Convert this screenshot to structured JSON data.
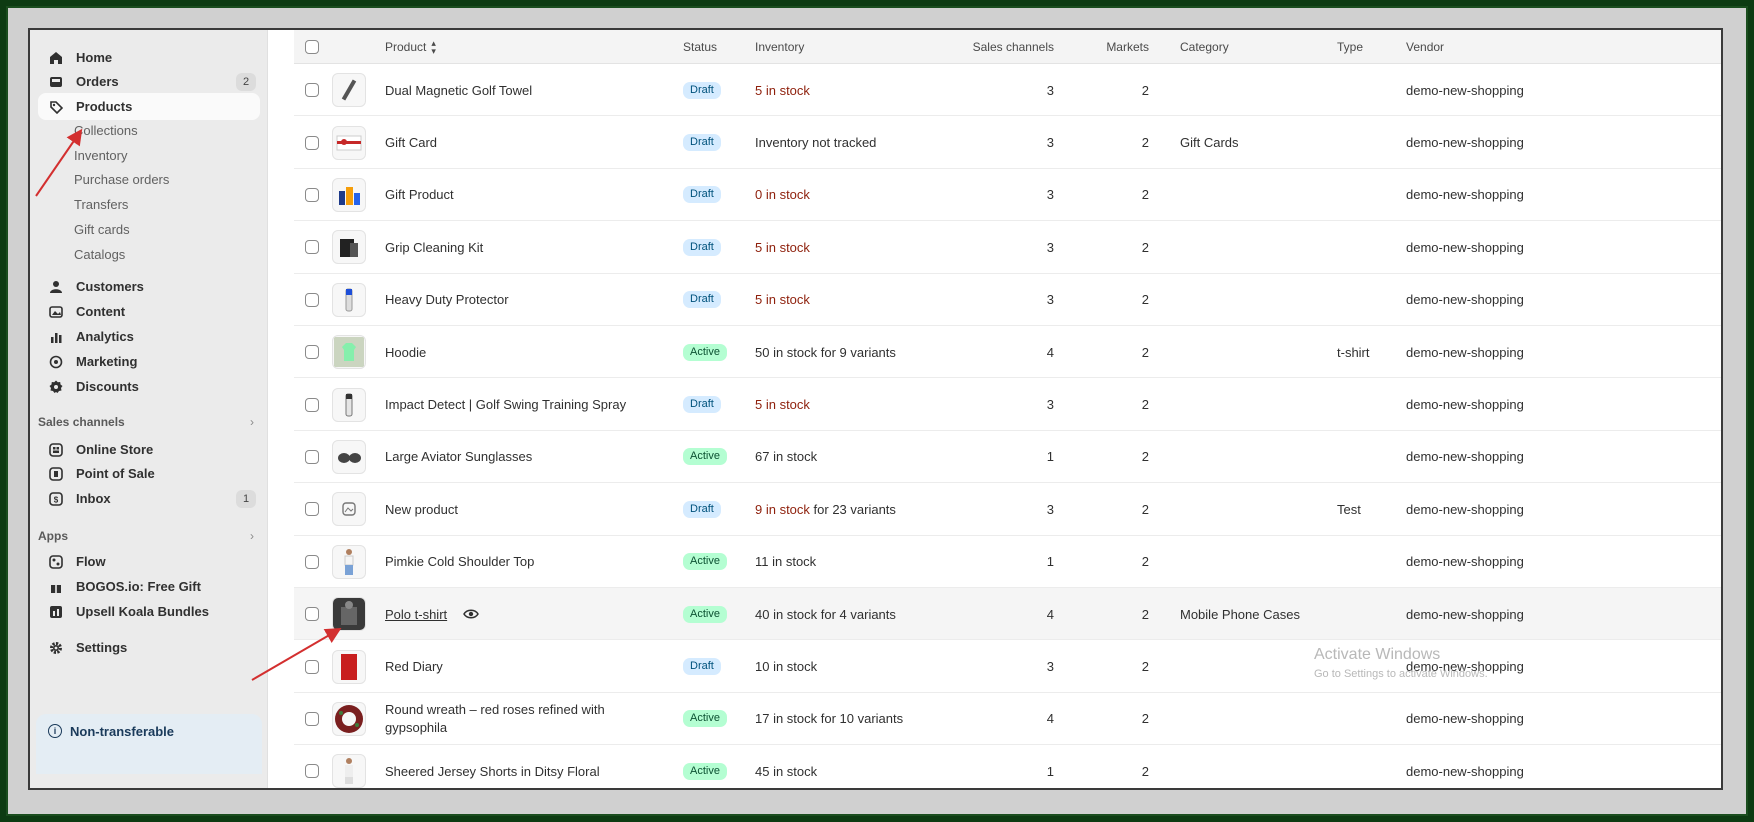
{
  "sidebar": {
    "items": [
      {
        "label": "Home",
        "icon": "home-icon"
      },
      {
        "label": "Orders",
        "icon": "inbox-icon",
        "badge": "2"
      },
      {
        "label": "Products",
        "icon": "tag-icon"
      }
    ],
    "product_sub": [
      "Collections",
      "Inventory",
      "Purchase orders",
      "Transfers",
      "Gift cards",
      "Catalogs"
    ],
    "items2": [
      {
        "label": "Customers",
        "icon": "person-icon"
      },
      {
        "label": "Content",
        "icon": "image-icon"
      },
      {
        "label": "Analytics",
        "icon": "bar-chart-icon"
      },
      {
        "label": "Marketing",
        "icon": "target-icon"
      },
      {
        "label": "Discounts",
        "icon": "discount-icon"
      }
    ],
    "sales_channels_label": "Sales channels",
    "channels": [
      {
        "label": "Online Store",
        "icon": "store-icon"
      },
      {
        "label": "Point of Sale",
        "icon": "pos-icon"
      },
      {
        "label": "Inbox",
        "icon": "inbox-app-icon",
        "badge": "1"
      }
    ],
    "apps_label": "Apps",
    "apps": [
      {
        "label": "Flow",
        "icon": "flow-icon"
      },
      {
        "label": "BOGOS.io: Free Gift",
        "icon": "gift-icon"
      },
      {
        "label": "Upsell Koala Bundles",
        "icon": "bundle-icon"
      }
    ],
    "settings_label": "Settings",
    "non_transferable": "Non-transferable"
  },
  "table": {
    "headers": {
      "product": "Product",
      "status": "Status",
      "inventory": "Inventory",
      "sales_channels": "Sales channels",
      "markets": "Markets",
      "category": "Category",
      "type": "Type",
      "vendor": "Vendor"
    },
    "rows": [
      {
        "name": "Dual Magnetic Golf Towel",
        "status": "Draft",
        "inv_low": "5 in stock",
        "inv_rest": "",
        "channels": "3",
        "markets": "2",
        "category": "",
        "type": "",
        "vendor": "demo-new-shopping"
      },
      {
        "name": "Gift Card",
        "status": "Draft",
        "inv_low": "",
        "inv_rest": "Inventory not tracked",
        "channels": "3",
        "markets": "2",
        "category": "Gift Cards",
        "type": "",
        "vendor": "demo-new-shopping"
      },
      {
        "name": "Gift Product",
        "status": "Draft",
        "inv_low": "0 in stock",
        "inv_rest": "",
        "channels": "3",
        "markets": "2",
        "category": "",
        "type": "",
        "vendor": "demo-new-shopping"
      },
      {
        "name": "Grip Cleaning Kit",
        "status": "Draft",
        "inv_low": "5 in stock",
        "inv_rest": "",
        "channels": "3",
        "markets": "2",
        "category": "",
        "type": "",
        "vendor": "demo-new-shopping"
      },
      {
        "name": "Heavy Duty Protector",
        "status": "Draft",
        "inv_low": "5 in stock",
        "inv_rest": "",
        "channels": "3",
        "markets": "2",
        "category": "",
        "type": "",
        "vendor": "demo-new-shopping"
      },
      {
        "name": "Hoodie",
        "status": "Active",
        "inv_low": "",
        "inv_rest": "50 in stock for 9 variants",
        "channels": "4",
        "markets": "2",
        "category": "",
        "type": "t-shirt",
        "vendor": "demo-new-shopping"
      },
      {
        "name": "Impact Detect | Golf Swing Training Spray",
        "status": "Draft",
        "inv_low": "5 in stock",
        "inv_rest": "",
        "channels": "3",
        "markets": "2",
        "category": "",
        "type": "",
        "vendor": "demo-new-shopping"
      },
      {
        "name": "Large Aviator Sunglasses",
        "status": "Active",
        "inv_low": "",
        "inv_rest": "67 in stock",
        "channels": "1",
        "markets": "2",
        "category": "",
        "type": "",
        "vendor": "demo-new-shopping"
      },
      {
        "name": "New product",
        "status": "Draft",
        "inv_low": "9 in stock",
        "inv_rest": " for 23 variants",
        "channels": "3",
        "markets": "2",
        "category": "",
        "type": "Test",
        "vendor": "demo-new-shopping"
      },
      {
        "name": "Pimkie Cold Shoulder Top",
        "status": "Active",
        "inv_low": "",
        "inv_rest": "11 in stock",
        "channels": "1",
        "markets": "2",
        "category": "",
        "type": "",
        "vendor": "demo-new-shopping"
      },
      {
        "name": "Polo t-shirt",
        "status": "Active",
        "inv_low": "",
        "inv_rest": "40 in stock for 4 variants",
        "channels": "4",
        "markets": "2",
        "category": "Mobile Phone Cases",
        "type": "",
        "vendor": "demo-new-shopping"
      },
      {
        "name": "Red Diary",
        "status": "Draft",
        "inv_low": "",
        "inv_rest": "10 in stock",
        "channels": "3",
        "markets": "2",
        "category": "",
        "type": "",
        "vendor": "demo-new-shopping"
      },
      {
        "name": "Round wreath – red roses refined with",
        "name2": "gypsophila",
        "status": "Active",
        "inv_low": "",
        "inv_rest": "17 in stock for 10 variants",
        "channels": "4",
        "markets": "2",
        "category": "",
        "type": "",
        "vendor": "demo-new-shopping"
      },
      {
        "name": "Sheered Jersey Shorts in Ditsy Floral",
        "status": "Active",
        "inv_low": "",
        "inv_rest": "45 in stock",
        "channels": "1",
        "markets": "2",
        "category": "",
        "type": "",
        "vendor": "demo-new-shopping"
      }
    ]
  },
  "watermark": {
    "title": "Activate Windows",
    "sub": "Go to Settings to activate Windows."
  },
  "colors": {
    "draft_bg": "#d5ebff",
    "active_bg": "#b4fed2",
    "low_stock": "#8e1f0b",
    "frame": "#0d3b12",
    "arrow": "#d32f2f"
  }
}
